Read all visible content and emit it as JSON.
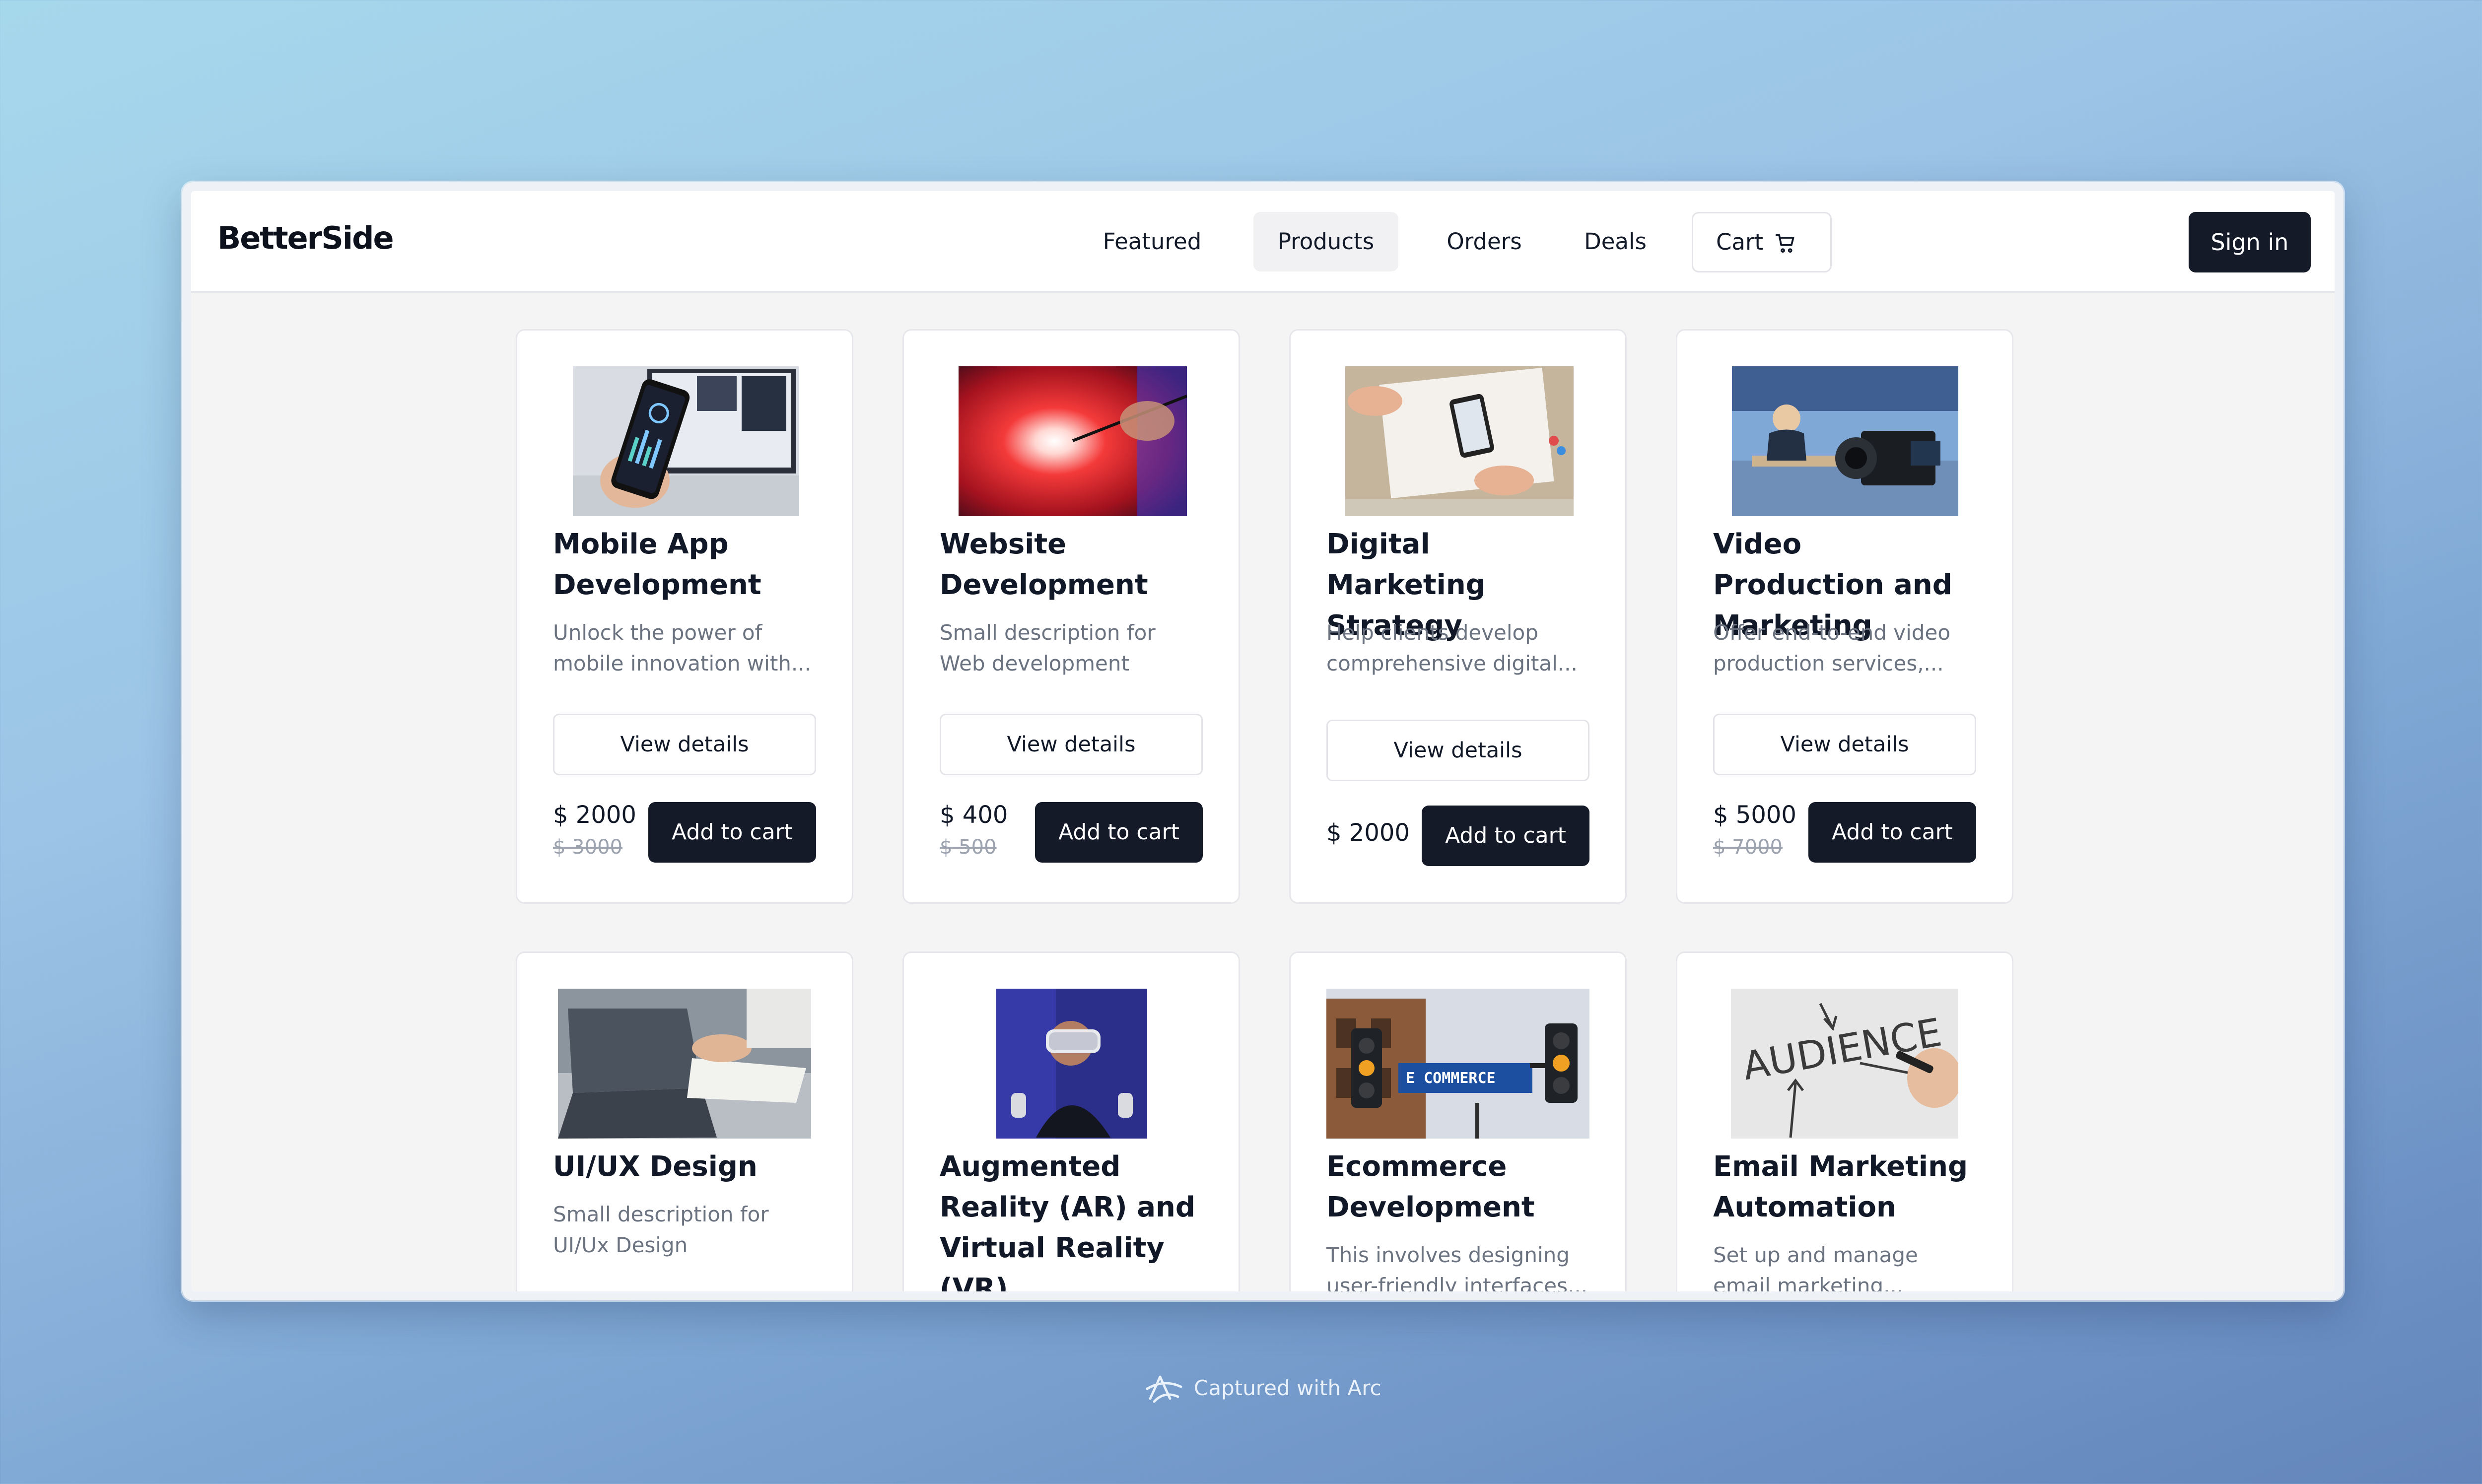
{
  "brand": "BetterSide",
  "nav": {
    "items": [
      "Featured",
      "Products",
      "Orders",
      "Deals"
    ],
    "active": "Products",
    "cart_label": "Cart",
    "cart_icon": "cart-icon",
    "signin_label": "Sign in"
  },
  "products": [
    {
      "title": "Mobile App Development",
      "desc": "Unlock the power of mobile innovation with...",
      "details_label": "View details",
      "price": "$ 2000",
      "old_price": "$ 3000",
      "cart_label": "Add to cart",
      "image": "phone-analytics-photo"
    },
    {
      "title": "Website Development",
      "desc": "Small description for Web development",
      "details_label": "View details",
      "price": "$ 400",
      "old_price": "$ 500",
      "cart_label": "Add to cart",
      "image": "red-light-burst-photo"
    },
    {
      "title": "Digital Marketing Strategy",
      "desc": "Help clients develop comprehensive digital...",
      "details_label": "View details",
      "price": "$ 2000",
      "old_price": "",
      "cart_label": "Add to cart",
      "image": "desk-planning-photo"
    },
    {
      "title": "Video Production and Marketing",
      "desc": "Offer end-to-end video production services,...",
      "details_label": "View details",
      "price": "$ 5000",
      "old_price": "$ 7000",
      "cart_label": "Add to cart",
      "image": "video-camera-studio-photo"
    },
    {
      "title": "UI/UX Design",
      "desc": "Small description for UI/Ux Design",
      "image": "laptop-meeting-photo"
    },
    {
      "title": "Augmented Reality (AR) and Virtual Reality (VR)",
      "desc": "",
      "image": "vr-headset-photo"
    },
    {
      "title": "Ecommerce Development",
      "desc": "This involves designing user-friendly interfaces...",
      "image": "ecommerce-street-sign-photo",
      "sign_text": "E COMMERCE"
    },
    {
      "title": "Email Marketing Automation",
      "desc": "Set up and manage email marketing...",
      "image": "audience-whiteboard-photo",
      "board_text": "AUDIENCE"
    }
  ],
  "footer": {
    "capture_label": "Captured with Arc",
    "capture_icon": "arc-logo-icon"
  },
  "colors": {
    "primary": "#141a28",
    "muted": "#6b7280",
    "strike": "#9ca3af",
    "card_border": "#e6e7ea"
  }
}
